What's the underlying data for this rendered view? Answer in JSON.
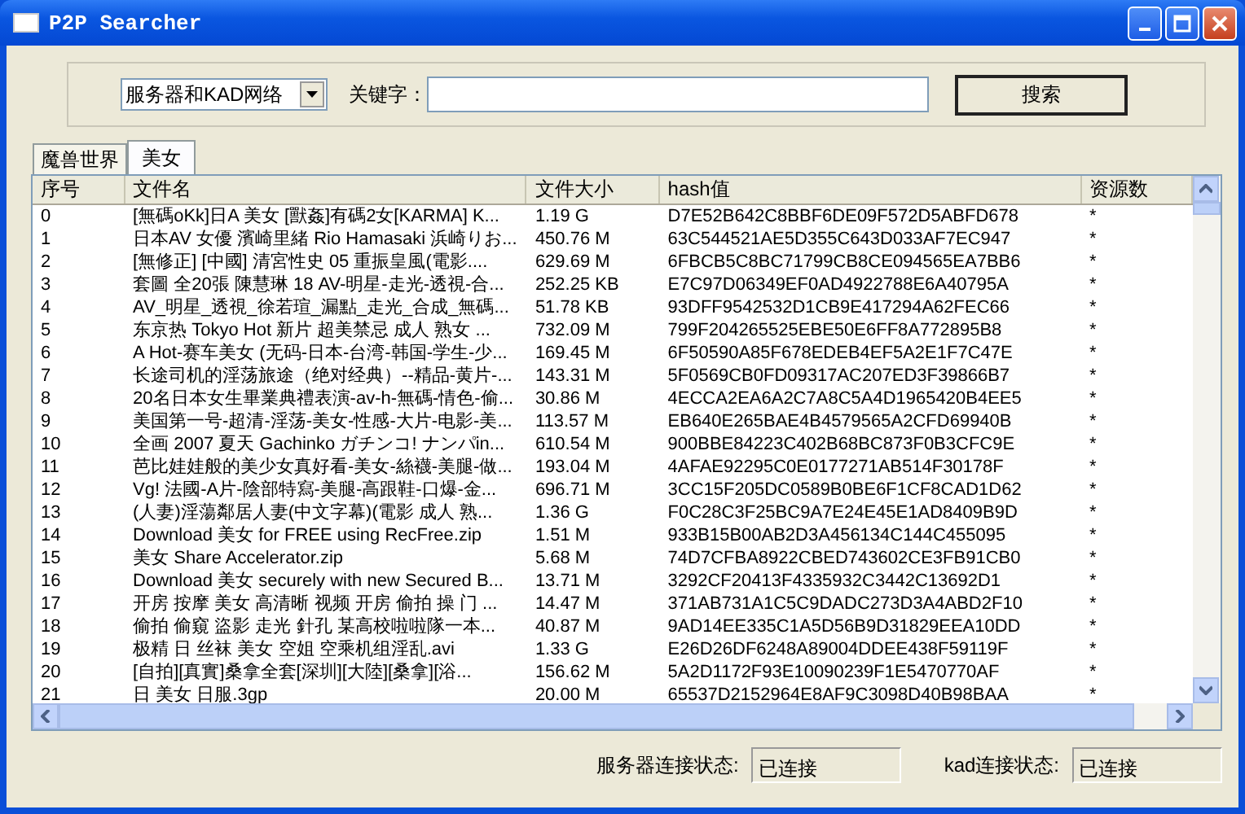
{
  "window": {
    "title": "P2P Searcher"
  },
  "search": {
    "network": "服务器和KAD网络",
    "keyword_label": "关键字：",
    "button": "搜索"
  },
  "tabs": [
    {
      "label": "魔兽世界",
      "selected": false
    },
    {
      "label": "美女",
      "selected": true
    }
  ],
  "table": {
    "columns": [
      "序号",
      "文件名",
      "文件大小",
      "hash值",
      "资源数"
    ],
    "rows": [
      [
        "0",
        "[無碼oKk]日A 美女 [獸姦]有碼2女[KARMA] K...",
        "1.19 G",
        "D7E52B642C8BBF6DE09F572D5ABFD678",
        "*"
      ],
      [
        "1",
        "日本AV 女優 濱崎里緒 Rio Hamasaki 浜崎りお...",
        "450.76 M",
        "63C544521AE5D355C643D033AF7EC947",
        "*"
      ],
      [
        "2",
        "[無修正] [中國] 清宮性史 05 重振皇風(電影....",
        "629.69 M",
        "6FBCB5C8BC71799CB8CE094565EA7BB6",
        "*"
      ],
      [
        "3",
        "套圖 全20張 陳慧琳 18 AV-明星-走光-透視-合...",
        "252.25 KB",
        "E7C97D06349EF0AD4922788E6A40795A",
        "*"
      ],
      [
        "4",
        "AV_明星_透視_徐若瑄_漏點_走光_合成_無碼...",
        "51.78 KB",
        "93DFF9542532D1CB9E417294A62FEC66",
        "*"
      ],
      [
        "5",
        "东京热 Tokyo Hot 新片 超美禁忌 成人 熟女 ...",
        "732.09 M",
        "799F204265525EBE50E6FF8A772895B8",
        "*"
      ],
      [
        "6",
        "A Hot-赛车美女 (无码-日本-台湾-韩国-学生-少...",
        "169.45 M",
        "6F50590A85F678EDEB4EF5A2E1F7C47E",
        "*"
      ],
      [
        "7",
        "长途司机的淫荡旅途（绝对经典）--精品-黄片-...",
        "143.31 M",
        "5F0569CB0FD09317AC207ED3F39866B7",
        "*"
      ],
      [
        "8",
        "20名日本女生畢業典禮表演-av-h-無碼-情色-偷...",
        "30.86 M",
        "4ECCA2EA6A2C7A8C5A4D1965420B4EE5",
        "*"
      ],
      [
        "9",
        "美国第一号-超清-淫荡-美女-性感-大片-电影-美...",
        "113.57 M",
        "EB640E265BAE4B4579565A2CFD69940B",
        "*"
      ],
      [
        "10",
        "全画 2007 夏天 Gachinko ガチンコ! ナンパin...",
        "610.54 M",
        "900BBE84223C402B68BC873F0B3CFC9E",
        "*"
      ],
      [
        "11",
        "芭比娃娃般的美少女真好看-美女-絲襪-美腿-做...",
        "193.04 M",
        "4AFAE92295C0E0177271AB514F30178F",
        "*"
      ],
      [
        "12",
        "Vg! 法國-A片-陰部特寫-美腿-高跟鞋-口爆-金...",
        "696.71 M",
        "3CC15F205DC0589B0BE6F1CF8CAD1D62",
        "*"
      ],
      [
        "13",
        "(人妻)淫蕩鄰居人妻(中文字幕)(電影 成人 熟...",
        "1.36 G",
        "F0C28C3F25BC9A7E24E45E1AD8409B9D",
        "*"
      ],
      [
        "14",
        "Download 美女 for FREE using RecFree.zip",
        "1.51 M",
        "933B15B00AB2D3A456134C144C455095",
        "*"
      ],
      [
        "15",
        "美女 Share Accelerator.zip",
        "5.68 M",
        "74D7CFBA8922CBED743602CE3FB91CB0",
        "*"
      ],
      [
        "16",
        "Download 美女 securely with new Secured B...",
        "13.71 M",
        "3292CF20413F4335932C3442C13692D1",
        "*"
      ],
      [
        "17",
        "开房 按摩 美女 高清晰 视频 开房 偷拍 操 门 ...",
        "14.47 M",
        "371AB731A1C5C9DADC273D3A4ABD2F10",
        "*"
      ],
      [
        "18",
        "偷拍 偷窺 盜影 走光 針孔 某高校啦啦隊一本...",
        "40.87 M",
        "9AD14EE335C1A5D56B9D31829EEA10DD",
        "*"
      ],
      [
        "19",
        "极精 日 丝袜 美女 空姐 空乘机组淫乱.avi",
        "1.33 G",
        "E26D26DF6248A89004DDEE438F59119F",
        "*"
      ],
      [
        "20",
        "[自拍][真實]桑拿全套[深圳][大陸][桑拿][浴...",
        "156.62 M",
        "5A2D1172F93E10090239F1E5470770AF",
        "*"
      ],
      [
        "21",
        "日 美女 日服.3gp",
        "20.00 M",
        "65537D2152964E8AF9C3098D40B98BAA",
        "*"
      ]
    ]
  },
  "status": [
    {
      "label": "服务器连接状态:",
      "value": "已连接"
    },
    {
      "label": "kad连接状态:",
      "value": "已连接"
    }
  ]
}
